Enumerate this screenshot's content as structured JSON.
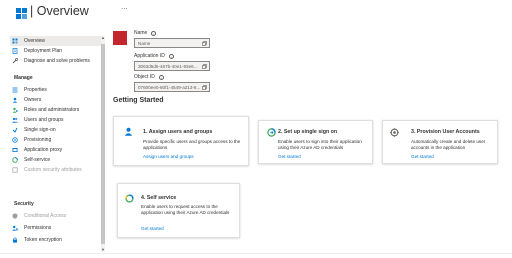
{
  "header": {
    "title": "| Overview",
    "more_label": "..."
  },
  "sidebar": {
    "items_top": [
      {
        "label": "Overview",
        "icon": "overview-icon",
        "selected": true
      },
      {
        "label": "Deployment Plan",
        "icon": "document-icon"
      },
      {
        "label": "Diagnose and solve problems",
        "icon": "wrench-icon"
      }
    ],
    "manage_heading": "Manage",
    "manage_items": [
      {
        "label": "Properties",
        "icon": "properties-icon"
      },
      {
        "label": "Owners",
        "icon": "owners-icon"
      },
      {
        "label": "Roles and administrators",
        "icon": "roles-icon"
      },
      {
        "label": "Users and groups",
        "icon": "users-icon"
      },
      {
        "label": "Single sign-on",
        "icon": "sso-icon"
      },
      {
        "label": "Provisioning",
        "icon": "provisioning-icon"
      },
      {
        "label": "Application proxy",
        "icon": "proxy-icon"
      },
      {
        "label": "Self-service",
        "icon": "self-service-icon"
      },
      {
        "label": "Custom security attributes",
        "icon": "attributes-icon",
        "disabled": true
      }
    ],
    "security_heading": "Security",
    "security_items": [
      {
        "label": "Conditional Access",
        "icon": "conditional-access-icon",
        "disabled": true
      },
      {
        "label": "Permissions",
        "icon": "permissions-icon"
      },
      {
        "label": "Token encryption",
        "icon": "token-icon"
      }
    ]
  },
  "properties": {
    "avatar_text": "",
    "name_label": "Name",
    "name_value": "Name",
    "app_id_label": "Application ID",
    "app_id_value": "3063d5d5-487b-40e1-93e6...",
    "object_id_label": "Object ID",
    "object_id_value": "07600ee0-80f1-4549-a213-8..."
  },
  "getting_started": {
    "heading": "Getting Started",
    "cards": [
      {
        "title": "1. Assign users and groups",
        "desc": "Provide specific users and groups access to the applications",
        "link": "Assign users and groups",
        "icon": "assign-users-icon"
      },
      {
        "title": "2. Set up single sign on",
        "desc": "Enable users to sign into their application using their Azure AD credentials",
        "link": "Get started",
        "icon": "single-sign-on-icon"
      },
      {
        "title": "3. Provision User Accounts",
        "desc": "Automatically create and delete user accounts in the application",
        "link": "Get started",
        "icon": "provision-icon"
      },
      {
        "title": "4. Self service",
        "desc": "Enable users to request access to the application using their Azure AD credentials",
        "link": "Get started",
        "icon": "self-service-icon"
      }
    ]
  },
  "colors": {
    "accent": "#0078d4",
    "avatar": "#c4262e",
    "selected_bg": "#edebe9",
    "disabled_text": "#a19f9d"
  }
}
